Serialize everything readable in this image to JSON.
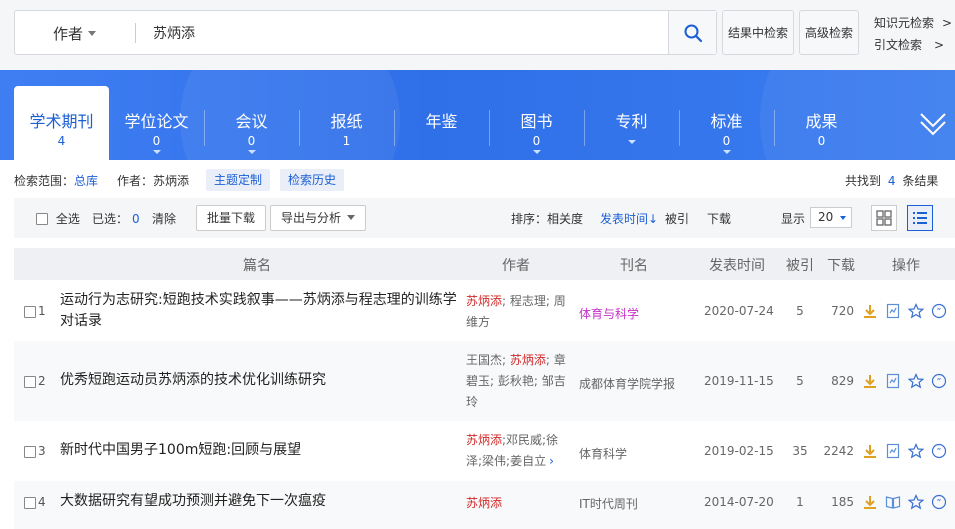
{
  "search": {
    "field": "作者",
    "query": "苏炳添",
    "search_in_results": "结果中检索",
    "advanced": "高级检索",
    "knowledge_search": "知识元检索",
    "citation_search": "引文检索",
    "arrow": ">"
  },
  "tabs": [
    {
      "label": "学术期刊",
      "count": "4"
    },
    {
      "label": "学位论文",
      "count": "0"
    },
    {
      "label": "会议",
      "count": "0"
    },
    {
      "label": "报纸",
      "count": "1"
    },
    {
      "label": "年鉴",
      "count": ""
    },
    {
      "label": "图书",
      "count": "0"
    },
    {
      "label": "专利",
      "count": ""
    },
    {
      "label": "标准",
      "count": "0"
    },
    {
      "label": "成果",
      "count": "0"
    }
  ],
  "info": {
    "scope_label": "检索范围：",
    "scope_value": "总库",
    "author_filter": "作者：苏炳添",
    "custom_topic": "主题定制",
    "history": "检索历史",
    "found_prefix": "共找到",
    "found_count": "4",
    "found_suffix": "条结果"
  },
  "toolbar": {
    "select_all": "全选",
    "selected_label": "已选：",
    "selected_count": "0",
    "clear": "清除",
    "batch_download": "批量下载",
    "export": "导出与分析",
    "sort_label": "排序：",
    "sort_relevance": "相关度",
    "sort_pubdate": "发表时间↓",
    "sort_cited": "被引",
    "sort_download": "下载",
    "display_label": "显示",
    "page_size": "20"
  },
  "table": {
    "headers": {
      "title": "篇名",
      "author": "作者",
      "source": "刊名",
      "date": "发表时间",
      "cited": "被引",
      "downloads": "下载",
      "actions": "操作"
    },
    "rows": [
      {
        "index": "1",
        "title": "运动行为志研究:短跑技术实践叙事——苏炳添与程志理的训练学对话录",
        "author_hl": "苏炳添",
        "author_rest": "; 程志理; 周维方",
        "source": "体育与科学",
        "date": "2020-07-24",
        "cited": "5",
        "downloads": "720"
      },
      {
        "index": "2",
        "title": "优秀短跑运动员苏炳添的技术优化训练研究",
        "author_pre": "王国杰; ",
        "author_hl": "苏炳添",
        "author_rest": "; 章碧玉; 彭秋艳; 邹吉玲",
        "source": "成都体育学院学报",
        "date": "2019-11-15",
        "cited": "5",
        "downloads": "829"
      },
      {
        "index": "3",
        "title": "新时代中国男子100m短跑:回顾与展望",
        "author_hl": "苏炳添",
        "author_rest": ";邓民威;徐泽;梁伟;姜自立",
        "author_more": "›",
        "source": "体育科学",
        "date": "2019-02-15",
        "cited": "35",
        "downloads": "2242"
      },
      {
        "index": "4",
        "title": "大数据研究有望成功预测并避免下一次瘟疫",
        "author_hl": "苏炳添",
        "source": "IT时代周刊",
        "date": "2014-07-20",
        "cited": "1",
        "downloads": "185"
      }
    ]
  },
  "colors": {
    "band": "#3478ee",
    "accent": "#1b5fd6",
    "highlight_author": "#d12a2a",
    "pink_source": "#c433c8"
  }
}
